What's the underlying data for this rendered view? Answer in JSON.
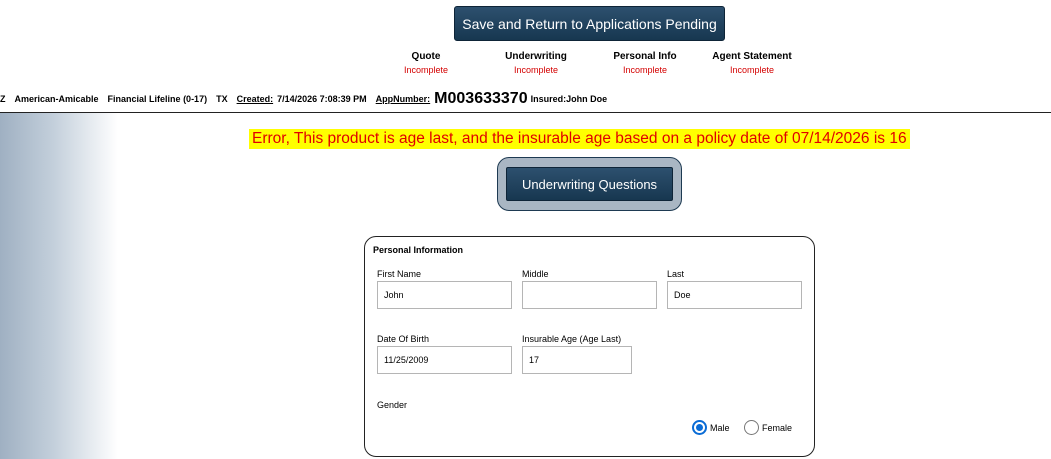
{
  "actions": {
    "save_return_label": "Save and Return to Applications Pending",
    "underwriting_questions_label": "Underwriting Questions"
  },
  "steps": [
    {
      "title": "Quote",
      "status": "Incomplete"
    },
    {
      "title": "Underwriting",
      "status": "Incomplete"
    },
    {
      "title": "Personal Info",
      "status": "Incomplete"
    },
    {
      "title": "Agent Statement",
      "status": "Incomplete"
    }
  ],
  "app_info": {
    "prefix": "Z",
    "carrier": "American-Amicable",
    "product": "Financial Lifeline (0-17)",
    "state": "TX",
    "created_label": "Created:",
    "created_value": "7/14/2026 7:08:39 PM",
    "appnumber_label": "AppNumber:",
    "appnumber_value": "M003633370",
    "insured": "Insured:John Doe"
  },
  "error_message": "Error, This product is age last, and the insurable age based on a policy date of 07/14/2026 is 16",
  "personal_info": {
    "title": "Personal Information",
    "first_name": {
      "label": "First Name",
      "value": "John"
    },
    "middle": {
      "label": "Middle",
      "value": ""
    },
    "last": {
      "label": "Last",
      "value": "Doe"
    },
    "dob": {
      "label": "Date Of Birth",
      "value": "11/25/2009"
    },
    "insurable_age": {
      "label": "Insurable Age (Age Last)",
      "value": "17"
    },
    "gender": {
      "label": "Gender",
      "options": [
        "Male",
        "Female"
      ],
      "selected": "Male"
    }
  },
  "colors": {
    "button_bg": "#1f405c",
    "error_text": "#e00000",
    "error_highlight": "#ffff00",
    "status_incomplete": "#d40000",
    "radio_selected": "#0a6cd6"
  }
}
